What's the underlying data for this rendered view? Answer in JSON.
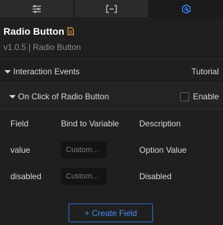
{
  "tabs": [
    {
      "icon": "sliders-icon"
    },
    {
      "icon": "bracket-icon"
    },
    {
      "icon": "event-icon",
      "active": true
    }
  ],
  "header": {
    "title": "Radio Button",
    "subtitle": "v1.0.5 | Radio Button"
  },
  "section": {
    "title": "Interaction Events",
    "tutorial": "Tutorial"
  },
  "event": {
    "title": "On Click of Radio Button",
    "enable_label": "Enable",
    "enabled": false
  },
  "table": {
    "headers": [
      "Field",
      "Bind to Variable",
      "Description"
    ],
    "rows": [
      {
        "field": "value",
        "placeholder": "Custom...",
        "description": "Option Value"
      },
      {
        "field": "disabled",
        "placeholder": "Custom...",
        "description": "Disabled"
      }
    ]
  },
  "create_button": "+ Create Field",
  "colors": {
    "background": "#1f1f1f",
    "accent": "#2f6fd6",
    "doc_icon": "#e8a33d"
  }
}
